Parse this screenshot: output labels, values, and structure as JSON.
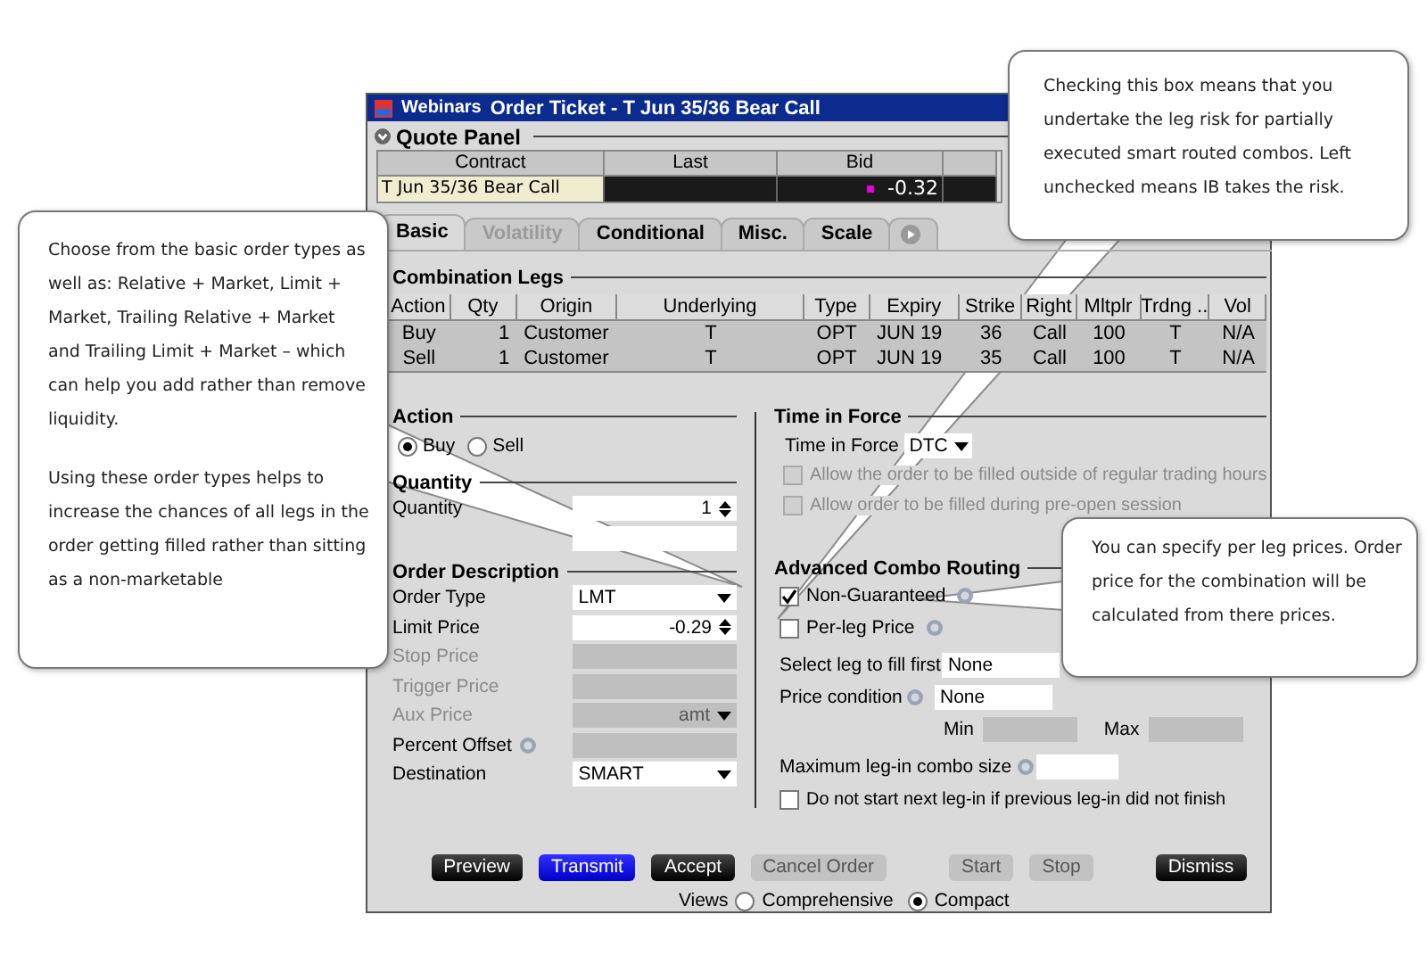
{
  "window": {
    "app": "Webinars",
    "title": "Order Ticket - T Jun 35/36 Bear Call"
  },
  "quote_panel": {
    "title": "Quote Panel",
    "columns": [
      "Contract",
      "Last",
      "Bid"
    ],
    "row": {
      "contract": "T Jun 35/36 Bear Call",
      "bid": "-0.32"
    }
  },
  "tabs": [
    {
      "label": "Basic",
      "selected": true,
      "disabled": false
    },
    {
      "label": "Volatility",
      "selected": false,
      "disabled": true
    },
    {
      "label": "Conditional",
      "selected": false,
      "disabled": false
    },
    {
      "label": "Misc.",
      "selected": false,
      "disabled": false
    },
    {
      "label": "Scale",
      "selected": false,
      "disabled": false
    }
  ],
  "combination_legs": {
    "title": "Combination Legs",
    "columns": [
      "Action",
      "Qty",
      "Origin",
      "Underlying",
      "Type",
      "Expiry",
      "Strike",
      "Right",
      "Mltplr",
      "Trdng ...",
      "Vol"
    ],
    "rows": [
      [
        "Buy",
        "1",
        "Customer",
        "T",
        "OPT",
        "JUN 19",
        "36",
        "Call",
        "100",
        "T",
        "N/A"
      ],
      [
        "Sell",
        "1",
        "Customer",
        "T",
        "OPT",
        "JUN 19",
        "35",
        "Call",
        "100",
        "T",
        "N/A"
      ]
    ]
  },
  "action": {
    "title": "Action",
    "options": [
      {
        "label": "Buy",
        "selected": true
      },
      {
        "label": "Sell",
        "selected": false
      }
    ]
  },
  "quantity": {
    "title": "Quantity",
    "fields": [
      {
        "label": "Quantity",
        "value": "1",
        "kind": "spinner"
      },
      {
        "kind": "text"
      }
    ]
  },
  "order_description": {
    "title": "Order Description",
    "fields": [
      {
        "label": "Order Type",
        "value": "LMT",
        "kind": "dropdown",
        "disabled": false,
        "editable": true,
        "help": false
      },
      {
        "label": "Limit Price",
        "value": "-0.29",
        "kind": "spinner",
        "disabled": false,
        "editable": true,
        "help": false
      },
      {
        "label": "Stop Price",
        "kind": "text",
        "disabled": true,
        "help": false
      },
      {
        "label": "Trigger Price",
        "kind": "text",
        "disabled": true,
        "help": false
      },
      {
        "label": "Aux Price",
        "value": "amt",
        "kind": "dropdown",
        "disabled": true,
        "help": false
      },
      {
        "label": "Percent Offset",
        "kind": "text",
        "disabled": false,
        "editable": false,
        "help": true
      },
      {
        "label": "Destination",
        "value": "SMART",
        "kind": "dropdown",
        "disabled": false,
        "editable": true,
        "help": false
      }
    ]
  },
  "time_in_force": {
    "title": "Time in Force",
    "label": "Time in Force",
    "value": "DTC",
    "options": [
      {
        "label": "Allow the order to be filled outside of regular trading hours",
        "checked": false,
        "disabled": true
      },
      {
        "label": "Allow order to be filled during pre-open session",
        "checked": false,
        "disabled": true
      }
    ]
  },
  "advanced_combo_routing": {
    "title": "Advanced Combo Routing",
    "checks": [
      {
        "label": "Non-Guaranteed",
        "checked": true,
        "help": true
      },
      {
        "label": "Per-leg Price",
        "checked": false,
        "help": true
      }
    ],
    "select_leg": {
      "label": "Select leg to fill first",
      "value": "None"
    },
    "price_condition": {
      "label": "Price condition",
      "value": "None",
      "help": true
    },
    "min_label": "Min",
    "max_label": "Max",
    "max_leg_in": {
      "label": "Maximum leg-in combo size",
      "help": true
    },
    "sequential": {
      "label": "Do not start next leg-in if previous leg-in did not finish",
      "checked": false
    }
  },
  "button_groups": [
    [
      {
        "label": "Preview",
        "kind": "dark"
      },
      {
        "label": "Transmit",
        "kind": "primary"
      },
      {
        "label": "Accept",
        "kind": "dark"
      },
      {
        "label": "Cancel Order",
        "kind": "disabled"
      }
    ],
    [
      {
        "label": "Start",
        "kind": "disabled"
      },
      {
        "label": "Stop",
        "kind": "disabled"
      }
    ],
    [
      {
        "label": "Dismiss",
        "kind": "dark"
      }
    ]
  ],
  "views": {
    "label": "Views",
    "options": [
      {
        "label": "Comprehensive",
        "selected": false
      },
      {
        "label": "Compact",
        "selected": true
      }
    ]
  },
  "callouts": [
    {
      "paragraphs": [
        "Choose from the basic order types as well as: Relative + Market, Limit + Market, Trailing Relative + Market and Trailing Limit + Market – which can help you add rather than remove liquidity.",
        "Using these order types helps to increase the chances of all legs in the order getting filled rather than sitting as a non-marketable"
      ]
    },
    {
      "paragraphs": [
        "Checking this box means that you undertake the leg risk for partially executed smart routed combos. Left unchecked means IB takes the risk."
      ]
    },
    {
      "paragraphs": [
        "You can specify per leg prices. Order price for the combination will be calculated from there prices."
      ]
    }
  ]
}
